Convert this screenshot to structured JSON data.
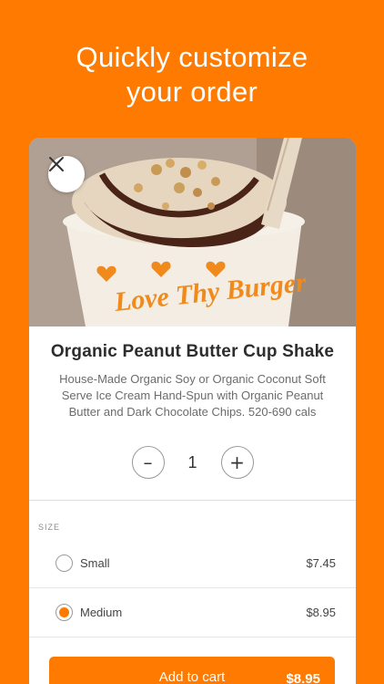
{
  "headline": {
    "line1": "Quickly customize",
    "line2": "your order"
  },
  "product": {
    "title": "Organic Peanut Butter Cup Shake",
    "description": "House-Made Organic Soy or Organic Coconut Soft Serve Ice Cream Hand-Spun with Organic Peanut Butter and Dark Chocolate Chips. 520-690 cals",
    "cup_text": "Love Thy Burger"
  },
  "quantity": {
    "value": "1",
    "minus": "–",
    "plus": "+"
  },
  "size": {
    "label": "SIZE",
    "options": [
      {
        "name": "Small",
        "price": "$7.45",
        "selected": false
      },
      {
        "name": "Medium",
        "price": "$8.95",
        "selected": true
      }
    ]
  },
  "cart": {
    "label": "Add to cart",
    "price": "$8.95"
  },
  "colors": {
    "brand": "#FF7A00",
    "text": "#2d2d2d"
  },
  "icons": {
    "close": "close-icon"
  }
}
